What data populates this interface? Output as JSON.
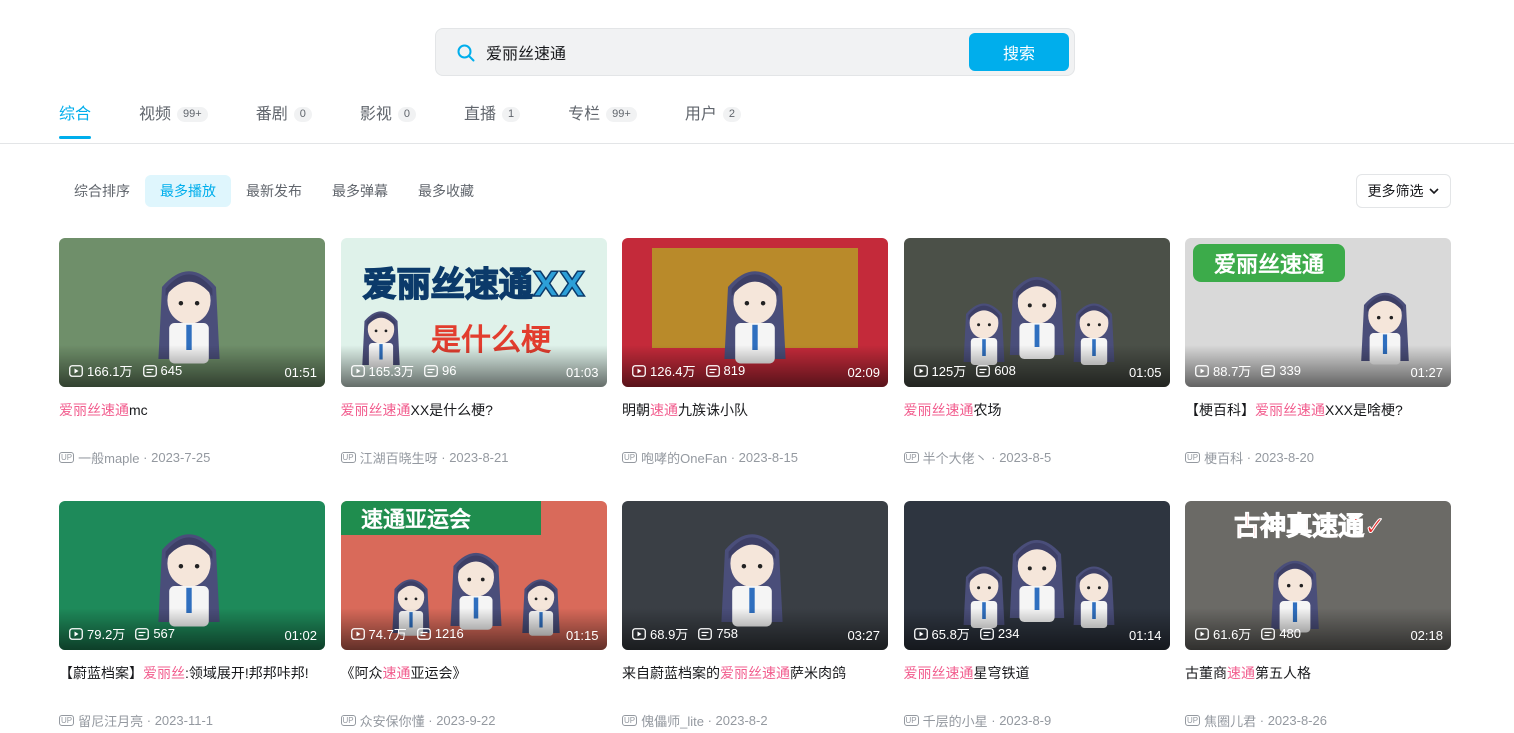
{
  "search": {
    "query": "爱丽丝速通",
    "button_label": "搜索"
  },
  "tabs": [
    {
      "label": "综合",
      "count": "",
      "active": true
    },
    {
      "label": "视频",
      "count": "99+"
    },
    {
      "label": "番剧",
      "count": "0"
    },
    {
      "label": "影视",
      "count": "0"
    },
    {
      "label": "直播",
      "count": "1"
    },
    {
      "label": "专栏",
      "count": "99+"
    },
    {
      "label": "用户",
      "count": "2"
    }
  ],
  "sorts": [
    "综合排序",
    "最多播放",
    "最新发布",
    "最多弹幕",
    "最多收藏"
  ],
  "active_sort": "最多播放",
  "more_filter": "更多筛选",
  "up_badge": "UP",
  "colors": {
    "accent": "#00aeec",
    "highlight": "#f25d8e"
  },
  "videos": [
    {
      "views": "166.1万",
      "danmaku": "645",
      "duration": "01:51",
      "title_parts": [
        {
          "t": "爱丽丝速通",
          "hl": true
        },
        {
          "t": "mc",
          "hl": false
        }
      ],
      "author": "一般maple",
      "date": "2023-7-25",
      "bg": "#6f8f6a"
    },
    {
      "views": "165.3万",
      "danmaku": "96",
      "duration": "01:03",
      "title_parts": [
        {
          "t": "爱丽丝速通",
          "hl": true
        },
        {
          "t": "XX是什么梗?",
          "hl": false
        }
      ],
      "author": "江湖百晓生呀",
      "date": "2023-8-21",
      "bg": "#dff2ea",
      "text_lines": [
        "爱丽丝速通XX",
        "是什么梗"
      ]
    },
    {
      "views": "126.4万",
      "danmaku": "819",
      "duration": "02:09",
      "title_parts": [
        {
          "t": "明朝",
          "hl": false
        },
        {
          "t": "速通",
          "hl": true
        },
        {
          "t": "九族诛小队",
          "hl": false
        }
      ],
      "author": "咆哮的OneFan",
      "date": "2023-8-15",
      "bg": "#c42a3a"
    },
    {
      "views": "125万",
      "danmaku": "608",
      "duration": "01:05",
      "title_parts": [
        {
          "t": "爱丽丝速通",
          "hl": true
        },
        {
          "t": "农场",
          "hl": false
        }
      ],
      "author": "半个大佬丶",
      "date": "2023-8-5",
      "bg": "#4b5048"
    },
    {
      "views": "88.7万",
      "danmaku": "339",
      "duration": "01:27",
      "title_parts": [
        {
          "t": "【梗百科】",
          "hl": false
        },
        {
          "t": "爱丽丝速通",
          "hl": true
        },
        {
          "t": "XXX是啥梗?",
          "hl": false
        }
      ],
      "author": "梗百科",
      "date": "2023-8-20",
      "bg": "#d9d9d9",
      "text_lines": [
        "爱丽丝速通"
      ]
    },
    {
      "views": "79.2万",
      "danmaku": "567",
      "duration": "01:02",
      "title_parts": [
        {
          "t": "【蔚蓝档案】",
          "hl": false
        },
        {
          "t": "爱丽丝",
          "hl": true
        },
        {
          "t": ":领域展开!邦邦咔邦!",
          "hl": false
        }
      ],
      "author": "留尼汪月亮",
      "date": "2023-11-1",
      "bg": "#1e8a5a"
    },
    {
      "views": "74.7万",
      "danmaku": "1216",
      "duration": "01:15",
      "title_parts": [
        {
          "t": "《阿众",
          "hl": false
        },
        {
          "t": "速通",
          "hl": true
        },
        {
          "t": "亚运会》",
          "hl": false
        }
      ],
      "author": "众安保你懂",
      "date": "2023-9-22",
      "bg": "#d96a5a",
      "text_lines": [
        "速通亚运会"
      ]
    },
    {
      "views": "68.9万",
      "danmaku": "758",
      "duration": "03:27",
      "title_parts": [
        {
          "t": "来自蔚蓝档案的",
          "hl": false
        },
        {
          "t": "爱丽丝速通",
          "hl": true
        },
        {
          "t": "萨米肉鸽",
          "hl": false
        }
      ],
      "author": "傀儡师_lite",
      "date": "2023-8-2",
      "bg": "#3a3f45"
    },
    {
      "views": "65.8万",
      "danmaku": "234",
      "duration": "01:14",
      "title_parts": [
        {
          "t": "爱丽丝速通",
          "hl": true
        },
        {
          "t": "星穹铁道",
          "hl": false
        }
      ],
      "author": "千层的小星",
      "date": "2023-8-9",
      "bg": "#2e3540"
    },
    {
      "views": "61.6万",
      "danmaku": "480",
      "duration": "02:18",
      "title_parts": [
        {
          "t": "古董商",
          "hl": false
        },
        {
          "t": "速通",
          "hl": true
        },
        {
          "t": "第五人格",
          "hl": false
        }
      ],
      "author": "焦圈儿君",
      "date": "2023-8-26",
      "bg": "#6b6a66",
      "text_lines": [
        "古神真速通✓"
      ]
    }
  ]
}
